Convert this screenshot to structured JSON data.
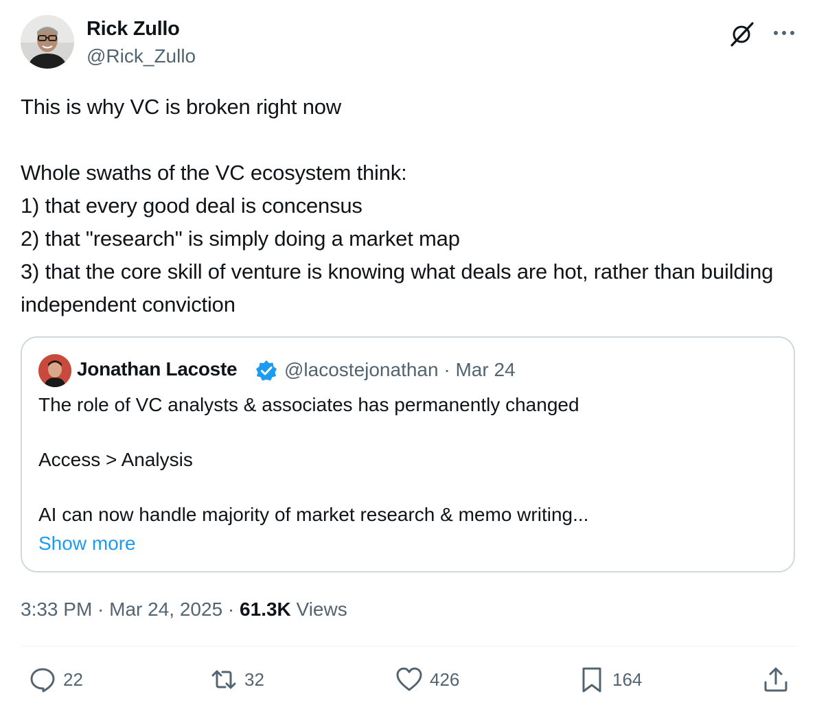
{
  "author": {
    "name": "Rick Zullo",
    "handle": "@Rick_Zullo",
    "avatar_icon": "user-avatar-photo"
  },
  "header_icons": [
    "grok-icon",
    "more-options-icon"
  ],
  "tweet": {
    "text": "This is why VC is broken right now\n\nWhole swaths of the VC ecosystem think:\n1) that every good deal is concensus\n2) that \"research\" is simply doing a market map\n3) that the core skill of venture is knowing what deals are hot, rather than building independent conviction"
  },
  "quote": {
    "name": "Jonathan Lacoste",
    "verified_icon": "verified-badge-icon",
    "meta": "@lacostejonathan · Mar 24",
    "text": "The role of VC analysts & associates has permanently changed\n\nAccess > Analysis\n\nAI can now handle majority of market research & memo writing...",
    "show_more": "Show more"
  },
  "meta": {
    "time_date": "3:33 PM · Mar 24, 2025 · ",
    "views_count": "61.3K",
    "views_label": " Views"
  },
  "actions": {
    "replies": "22",
    "reposts": "32",
    "likes": "426",
    "bookmarks": "164"
  },
  "colors": {
    "text": "#0f1419",
    "secondary": "#536471",
    "link": "#1d9bf0",
    "border": "#cfd9de"
  }
}
